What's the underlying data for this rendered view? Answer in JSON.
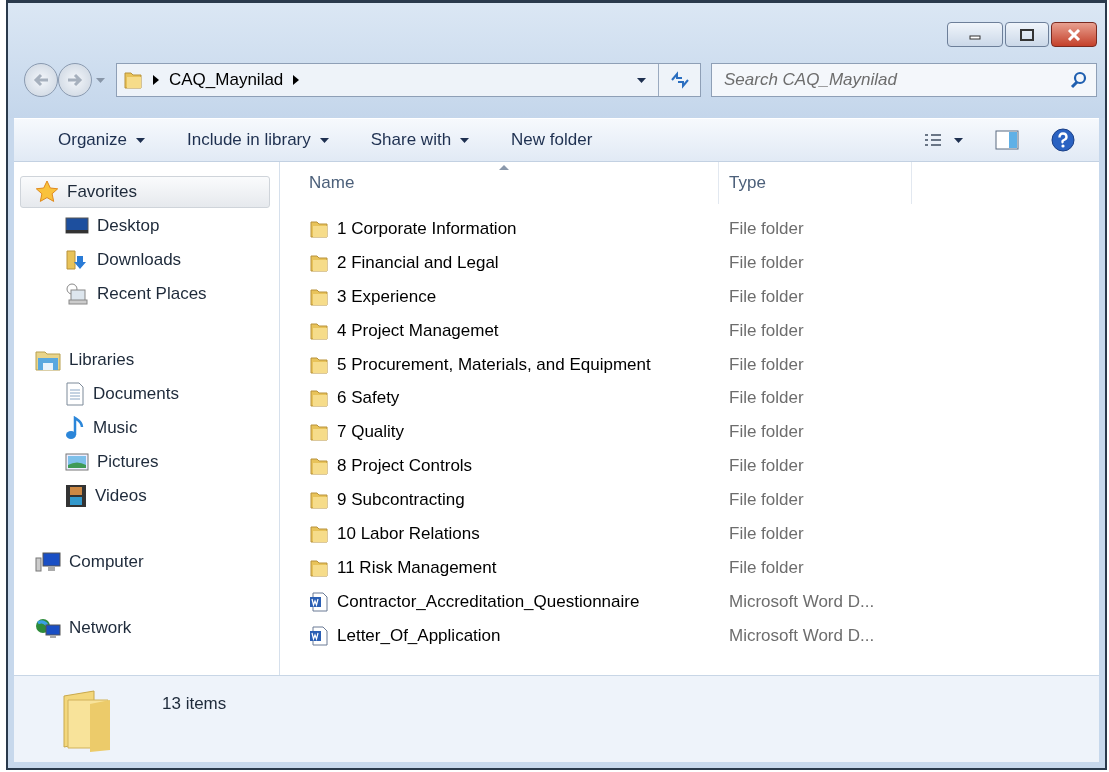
{
  "address_bar": {
    "segments": [
      "CAQ_Maynilad"
    ]
  },
  "search": {
    "placeholder": "Search CAQ_Maynilad"
  },
  "toolbar": {
    "items": [
      {
        "label": "Organize",
        "dropdown": true
      },
      {
        "label": "Include in library",
        "dropdown": true
      },
      {
        "label": "Share with",
        "dropdown": true
      },
      {
        "label": "New folder",
        "dropdown": false
      }
    ]
  },
  "sidebar": {
    "groups": [
      {
        "label": "Favorites",
        "selected": true,
        "children": [
          {
            "label": "Desktop",
            "selected": false
          },
          {
            "label": "Downloads",
            "selected": false
          },
          {
            "label": "Recent Places",
            "selected": false
          }
        ]
      },
      {
        "label": "Libraries",
        "selected": false,
        "children": [
          {
            "label": "Documents",
            "selected": false
          },
          {
            "label": "Music",
            "selected": false
          },
          {
            "label": "Pictures",
            "selected": false
          },
          {
            "label": "Videos",
            "selected": false
          }
        ]
      },
      {
        "label": "Computer",
        "selected": false
      },
      {
        "label": "Network",
        "selected": false
      }
    ]
  },
  "file_list": {
    "columns": [
      {
        "label": "Name",
        "sorted": true
      },
      {
        "label": "Type",
        "sorted": false
      }
    ],
    "rows": [
      {
        "name": "1 Corporate Information",
        "type": "File folder",
        "kind": "folder"
      },
      {
        "name": "2 Financial and Legal",
        "type": "File folder",
        "kind": "folder"
      },
      {
        "name": "3 Experience",
        "type": "File folder",
        "kind": "folder"
      },
      {
        "name": "4 Project Managemet",
        "type": "File folder",
        "kind": "folder"
      },
      {
        "name": "5 Procurement, Materials, and Equipment",
        "type": "File folder",
        "kind": "folder"
      },
      {
        "name": "6 Safety",
        "type": "File folder",
        "kind": "folder"
      },
      {
        "name": "7 Quality",
        "type": "File folder",
        "kind": "folder"
      },
      {
        "name": "8 Project Controls",
        "type": "File folder",
        "kind": "folder"
      },
      {
        "name": "9 Subcontracting",
        "type": "File folder",
        "kind": "folder"
      },
      {
        "name": "10 Labor Relations",
        "type": "File folder",
        "kind": "folder"
      },
      {
        "name": "11 Risk Management",
        "type": "File folder",
        "kind": "folder"
      },
      {
        "name": "Contractor_Accreditation_Questionnaire",
        "type": "Microsoft Word D...",
        "kind": "document"
      },
      {
        "name": "Letter_Of_Application",
        "type": "Microsoft Word D...",
        "kind": "document"
      }
    ]
  },
  "details_pane": {
    "summary": "13 items"
  }
}
